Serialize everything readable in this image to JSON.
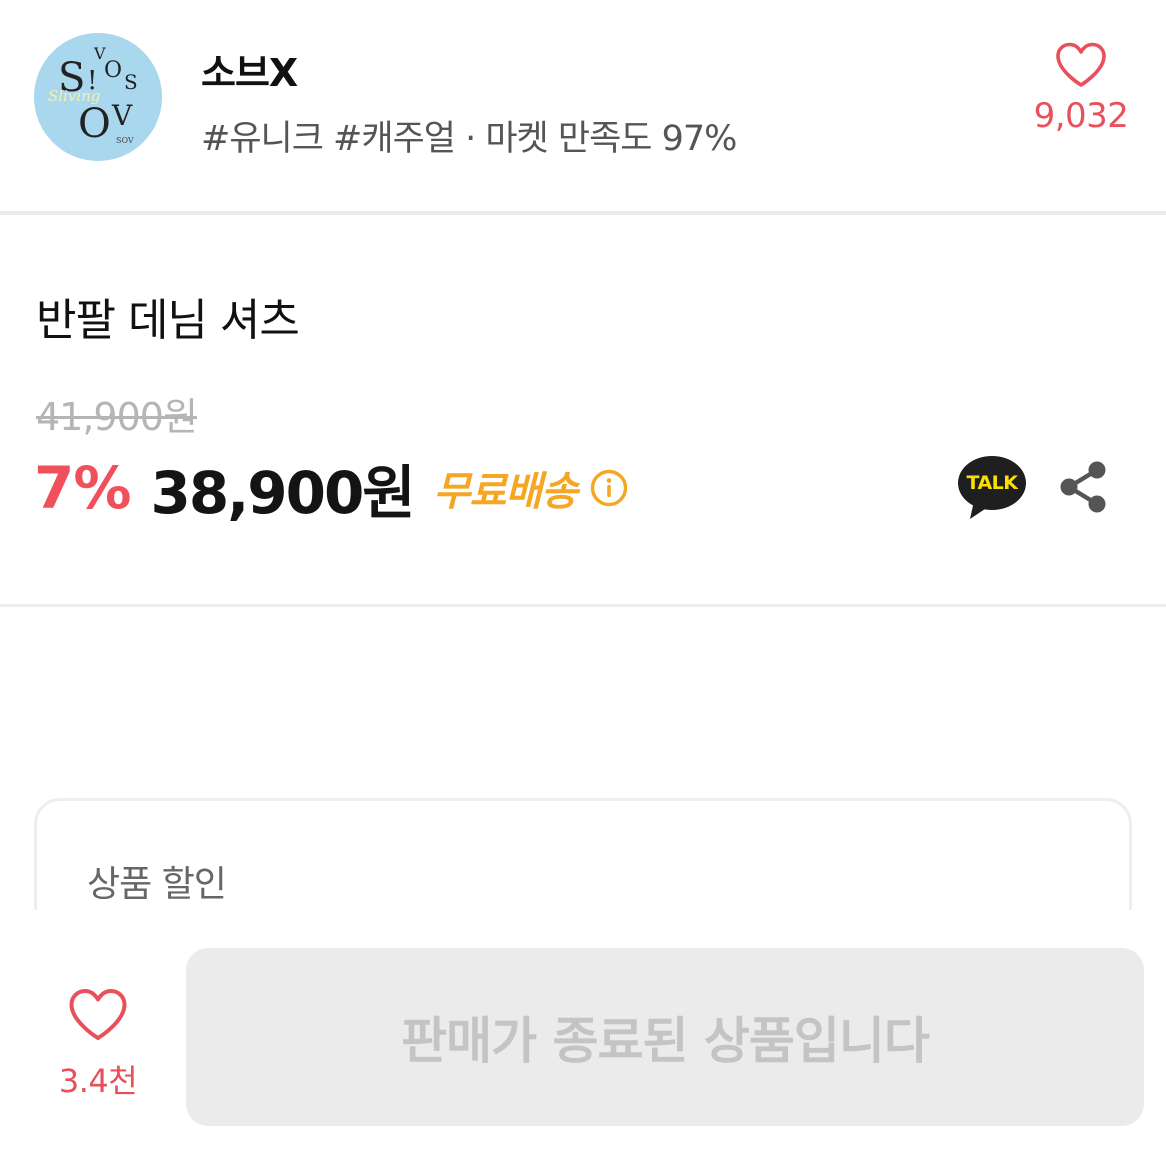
{
  "shop": {
    "name": "소브X",
    "tags": "#유니크 #캐주얼 · 마켓 만족도 97%",
    "logo_text": {
      "top": "vos",
      "middle": "S!os",
      "script": "Sliving",
      "bottom": "OV",
      "footer": "SOV"
    },
    "like_count": "9,032",
    "like_icon": "heart-outline-icon"
  },
  "product": {
    "title": "반팔 데님 셔츠",
    "original_price": "41,900원",
    "discount_rate": "7%",
    "sale_price": "38,900원",
    "shipping": "무료배송",
    "info_icon": "info-circle-icon",
    "talk_label": "TALK",
    "share_icon": "share-icon"
  },
  "discount_card": {
    "title": "상품 할인"
  },
  "bottom_bar": {
    "like_count": "3.4천",
    "status_button": "판매가 종료된 상품입니다"
  },
  "colors": {
    "accent_red": "#e8505b",
    "shipping_orange": "#f5a623",
    "talk_bubble": "#1f1f1f",
    "talk_text": "#f9e000",
    "logo_bg": "#a9d8ee"
  }
}
